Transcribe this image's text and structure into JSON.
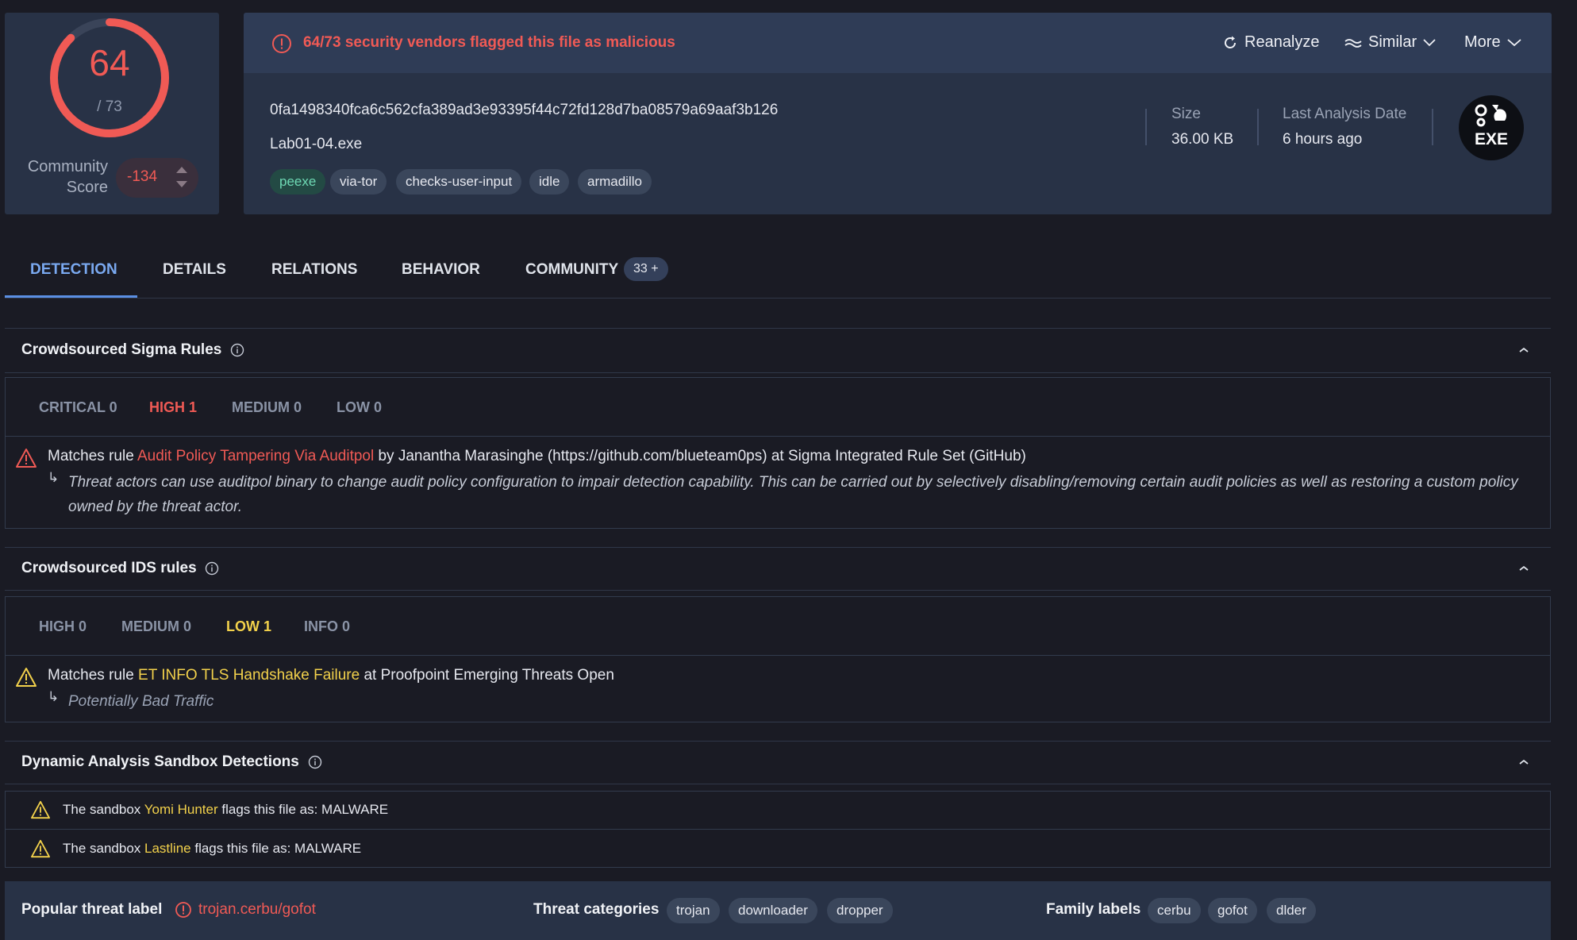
{
  "score": {
    "detections": "64",
    "total": "/ 73",
    "detection_fraction": 0.877,
    "community_label_1": "Community",
    "community_label_2": "Score",
    "community_value": "-134"
  },
  "header": {
    "alert": "64/73 security vendors flagged this file as malicious",
    "reanalyze": "Reanalyze",
    "similar": "Similar",
    "more": "More",
    "hash": "0fa1498340fca6c562cfa389ad3e93395f44c72fd128d7ba08579a69aaf3b126",
    "filename": "Lab01-04.exe",
    "tags": [
      "peexe",
      "via-tor",
      "checks-user-input",
      "idle",
      "armadillo"
    ],
    "size_label": "Size",
    "size_value": "36.00 KB",
    "date_label": "Last Analysis Date",
    "date_value": "6 hours ago",
    "file_type": "EXE"
  },
  "tabs": {
    "detection": "DETECTION",
    "details": "DETAILS",
    "relations": "RELATIONS",
    "behavior": "BEHAVIOR",
    "community": "COMMUNITY",
    "community_badge": "33 +"
  },
  "sigma": {
    "title": "Crowdsourced Sigma Rules",
    "critical": "CRITICAL 0",
    "high": "HIGH 1",
    "medium": "MEDIUM 0",
    "low": "LOW 0",
    "rule_prefix": "Matches rule ",
    "rule_name": "Audit Policy Tampering Via Auditpol",
    "rule_suffix": " by Janantha Marasinghe (https://github.com/blueteam0ps) at Sigma Integrated Rule Set (GitHub)",
    "arrow": "↳",
    "description": "Threat actors can use auditpol binary to change audit policy configuration to impair detection capability. This can be carried out by selectively disabling/removing certain audit policies as well as restoring a custom policy owned by the threat actor."
  },
  "ids": {
    "title": "Crowdsourced IDS rules",
    "high": "HIGH 0",
    "medium": "MEDIUM 0",
    "low": "LOW 1",
    "info": "INFO 0",
    "rule_prefix": "Matches rule ",
    "rule_name": "ET INFO TLS Handshake Failure",
    "rule_suffix": " at Proofpoint Emerging Threats Open",
    "arrow": "↳",
    "description": "Potentially Bad Traffic"
  },
  "sandbox": {
    "title": "Dynamic Analysis Sandbox Detections",
    "rows": [
      {
        "prefix": "The sandbox ",
        "name": "Yomi Hunter",
        "suffix": " flags this file as: MALWARE"
      },
      {
        "prefix": "The sandbox ",
        "name": "Lastline",
        "suffix": " flags this file as: MALWARE"
      }
    ]
  },
  "bottom": {
    "popular_label": "Popular threat label",
    "popular_value": "trojan.cerbu/gofot",
    "categories_label": "Threat categories",
    "categories": [
      "trojan",
      "downloader",
      "dropper"
    ],
    "family_label": "Family labels",
    "families": [
      "cerbu",
      "gofot",
      "dlder"
    ]
  },
  "colors": {
    "malicious": "#f05a55",
    "warning": "#f2d14b",
    "accent": "#5b8fe3",
    "panel": "#283246",
    "background": "#1a1b24"
  }
}
